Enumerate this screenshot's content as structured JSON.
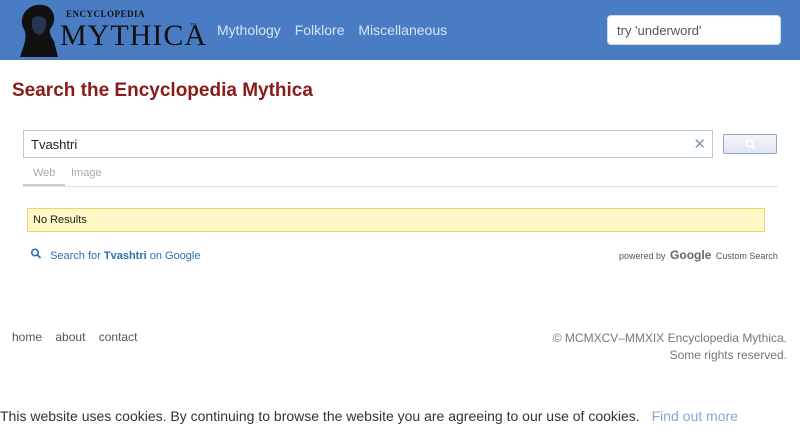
{
  "header": {
    "logo_small": "ENCYCLOPEDIA",
    "logo_big": "MYTHICA",
    "logo_tm": "™",
    "nav": [
      "Mythology",
      "Folklore",
      "Miscellaneous"
    ],
    "search_placeholder": "try 'underword'"
  },
  "main": {
    "title": "Search the Encyclopedia Mythica",
    "cse": {
      "query": "Tvashtri",
      "clear_symbol": "✕",
      "tabs": [
        "Web",
        "Image"
      ],
      "no_results": "No Results",
      "search_google_prefix": "Search for ",
      "search_google_term": "Tvashtri",
      "search_google_suffix": " on Google",
      "powered_by": "powered by",
      "google": "Google",
      "custom_search": "Custom Search"
    }
  },
  "footer": {
    "links": [
      "home",
      "about",
      "contact"
    ],
    "copyright_line1": "© MCMXCV–MMXIX Encyclopedia Mythica.",
    "copyright_line2": "Some rights reserved."
  },
  "cookie": {
    "text": "This website uses cookies. By continuing to browse the website you are agreeing to our use of cookies.",
    "link": "Find out more"
  },
  "colors": {
    "header_bg": "#4a7cc4",
    "title": "#8b1a1a",
    "link": "#2a6fb3",
    "notice_bg": "#fff8c6"
  }
}
